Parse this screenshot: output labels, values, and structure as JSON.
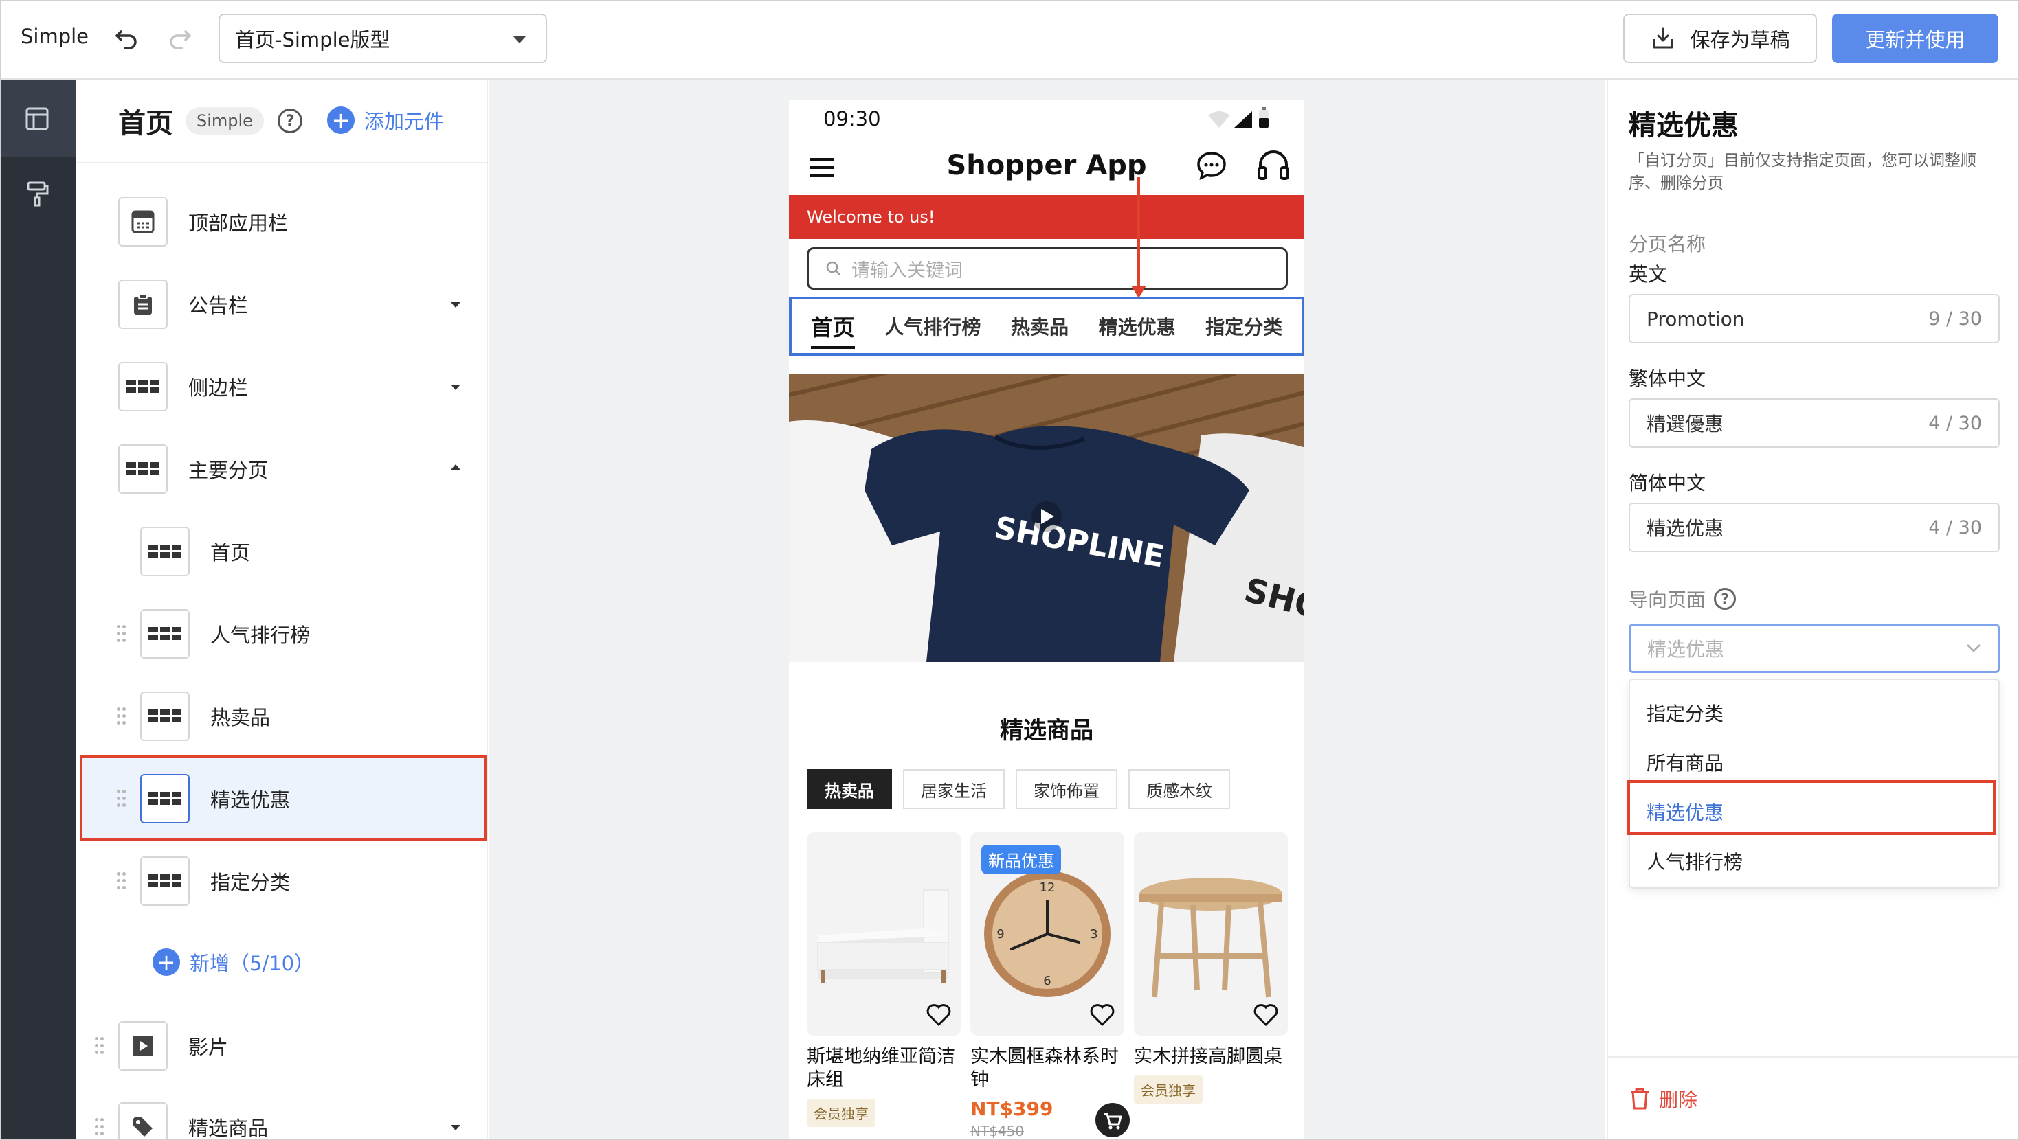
{
  "topbar": {
    "brand": "Simple",
    "template_select": "首页-Simple版型",
    "save_draft": "保存为草稿",
    "publish": "更新并使用"
  },
  "rail": {
    "items": [
      {
        "icon": "layout-icon",
        "active": true
      },
      {
        "icon": "paint-roller-icon",
        "active": false
      }
    ]
  },
  "left_panel": {
    "title": "首页",
    "badge": "Simple",
    "help_icon": "question-icon",
    "add_component": "添加元件",
    "items": [
      {
        "label": "顶部应用栏",
        "icon": "app-bar-icon",
        "caret": "none"
      },
      {
        "label": "公告栏",
        "icon": "clipboard-icon",
        "caret": "down"
      },
      {
        "label": "侧边栏",
        "icon": "grid-icon",
        "caret": "down"
      },
      {
        "label": "主要分页",
        "icon": "grid-icon",
        "caret": "up"
      },
      {
        "label": "首页",
        "icon": "grid-icon",
        "child": true
      },
      {
        "label": "人气排行榜",
        "icon": "grid-icon",
        "child": true
      },
      {
        "label": "热卖品",
        "icon": "grid-icon",
        "child": true
      },
      {
        "label": "精选优惠",
        "icon": "grid-icon",
        "child": true,
        "selected": true
      },
      {
        "label": "指定分类",
        "icon": "grid-icon",
        "child": true
      },
      {
        "label": "影片",
        "icon": "play-icon",
        "caret": "none"
      },
      {
        "label": "精选商品",
        "icon": "tag-icon",
        "caret": "down"
      }
    ],
    "add_tab": "新增（5/10）"
  },
  "preview": {
    "status_time": "09:30",
    "app_title": "Shopper App",
    "welcome": "Welcome to us!",
    "search_placeholder": "请输入关键词",
    "tabs": [
      "首页",
      "人气排行榜",
      "热卖品",
      "精选优惠",
      "指定分类"
    ],
    "active_tab": 0,
    "banner_text": "SHOPLINE",
    "section_title": "精选商品",
    "chips": [
      "热卖品",
      "居家生活",
      "家饰佈置",
      "质感木纹"
    ],
    "products": [
      {
        "name": "斯堪地纳维亚简洁床组",
        "tag": "会员独享",
        "image": "bed"
      },
      {
        "name": "实木圆框森林系时钟",
        "price": "NT$399",
        "old_price": "NT$450",
        "badge": "新品优惠",
        "image": "clock"
      },
      {
        "name": "实木拼接高脚圆桌",
        "tag": "会员独享",
        "image": "table"
      }
    ]
  },
  "right_panel": {
    "title": "精选优惠",
    "desc": "「自订分页」目前仅支持指定页面，您可以调整顺序、删除分页",
    "tab_name_label": "分页名称",
    "fields": [
      {
        "label": "英文",
        "value": "Promotion",
        "count": "9 / 30"
      },
      {
        "label": "繁体中文",
        "value": "精選優惠",
        "count": "4 / 30"
      },
      {
        "label": "简体中文",
        "value": "精选优惠",
        "count": "4 / 30"
      }
    ],
    "target_label": "导向页面",
    "target_value": "精选优惠",
    "options": [
      "指定分类",
      "所有商品",
      "精选优惠",
      "人气排行榜"
    ],
    "selected_option": "精选优惠",
    "delete": "删除"
  },
  "colors": {
    "accent": "#4a7ee8",
    "highlight": "#e0412d",
    "welcome_bar": "#d8322a",
    "rail": "#2b3039"
  }
}
